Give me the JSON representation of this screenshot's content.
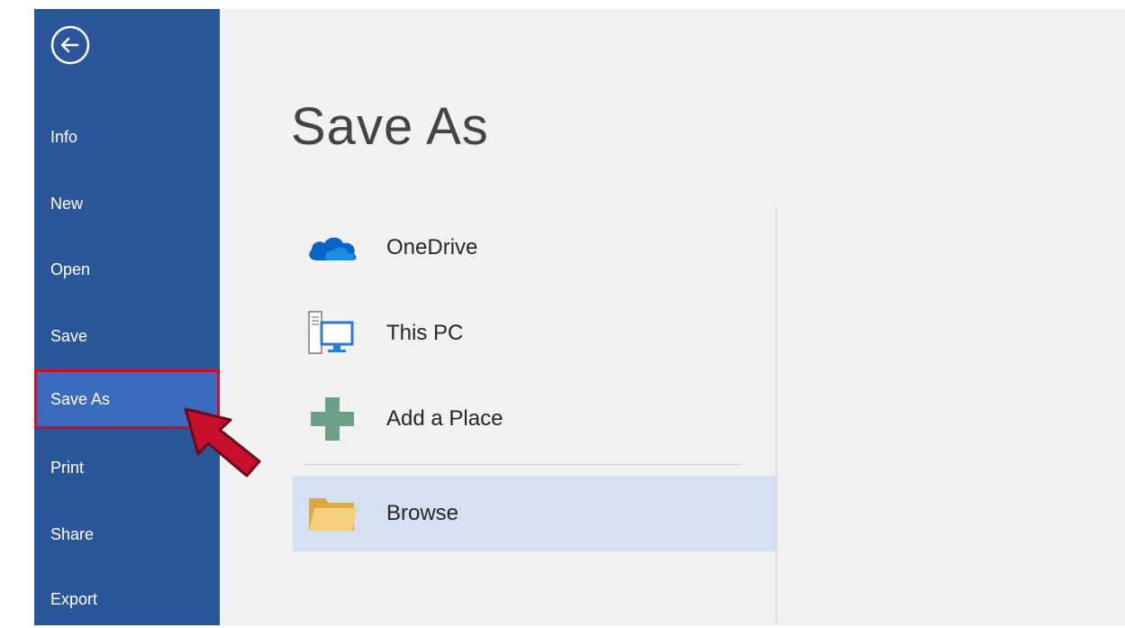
{
  "sidebar": {
    "back_icon": "back-arrow-circle-icon",
    "items": [
      {
        "label": "Info"
      },
      {
        "label": "New"
      },
      {
        "label": "Open"
      },
      {
        "label": "Save"
      },
      {
        "label": "Save As",
        "selected": true
      },
      {
        "label": "Print"
      },
      {
        "label": "Share"
      },
      {
        "label": "Export"
      }
    ]
  },
  "main": {
    "title": "Save As",
    "locations": [
      {
        "label": "OneDrive",
        "icon": "onedrive-cloud-icon"
      },
      {
        "label": "This PC",
        "icon": "computer-icon"
      },
      {
        "label": "Add a Place",
        "icon": "plus-icon"
      },
      {
        "label": "Browse",
        "icon": "folder-icon",
        "highlighted": true
      }
    ]
  },
  "colors": {
    "sidebar_bg": "#2b579a",
    "selected_bg": "#3b6bbd",
    "annotation_red": "#c8102e",
    "main_bg": "#f1f1f1",
    "browse_highlight": "#d5e1f2"
  }
}
